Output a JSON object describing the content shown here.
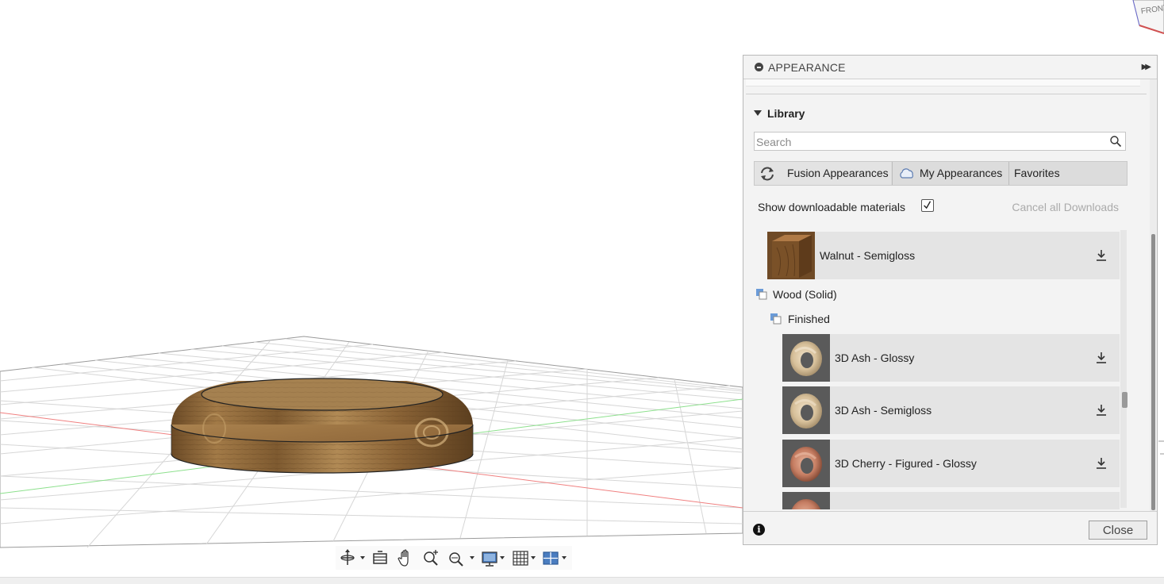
{
  "viewcube": {
    "face_label": "FRONT"
  },
  "panel": {
    "title": "APPEARANCE",
    "library": {
      "title": "Library",
      "search_placeholder": "Search",
      "search_value": "",
      "tabs": [
        {
          "label": "Fusion Appearances",
          "icon": "sync-icon"
        },
        {
          "label": "My Appearances",
          "icon": "cloud-icon"
        },
        {
          "label": "Favorites",
          "icon": ""
        }
      ],
      "show_downloadable_label": "Show downloadable materials",
      "show_downloadable_checked": true,
      "cancel_downloads_label": "Cancel all Downloads"
    },
    "list": {
      "top_material": {
        "name": "Walnut - Semigloss",
        "thumb": "wood-cube"
      },
      "category": "Wood (Solid)",
      "subcategory": "Finished",
      "materials": [
        {
          "name": "3D Ash - Glossy",
          "thumb": "ash-torus"
        },
        {
          "name": "3D Ash - Semigloss",
          "thumb": "ash-torus"
        },
        {
          "name": "3D Cherry - Figured - Glossy",
          "thumb": "cherry-torus"
        }
      ]
    },
    "footer": {
      "close_label": "Close"
    }
  },
  "colors": {
    "panel_bg": "#f3f3f3",
    "row_bg": "#e4e4e4",
    "disabled_text": "#aaaaaa",
    "grid_line": "#d6d6d6",
    "x_axis": "#f08080",
    "y_axis": "#8de08d"
  },
  "toolbar": {
    "icons": [
      "orbit-icon",
      "look-at-icon",
      "pan-icon",
      "zoom-icon",
      "fit-icon",
      "display-settings-icon",
      "grid-settings-icon",
      "viewports-icon"
    ]
  }
}
